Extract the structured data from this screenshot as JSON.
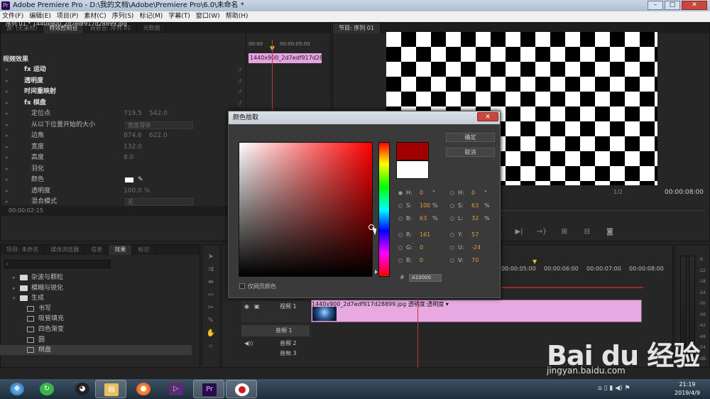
{
  "window": {
    "title": "Adobe Premiere Pro - D:\\我的文档\\Adobe\\Premiere Pro\\6.0\\未命名 *",
    "app_icon": "Pr"
  },
  "menu": [
    "文件(F)",
    "编辑(E)",
    "项目(P)",
    "素材(C)",
    "序列(S)",
    "标记(M)",
    "字幕(T)",
    "窗口(W)",
    "帮助(H)"
  ],
  "left_panel": {
    "tabs": [
      "源: (无素材)",
      "特效控制台",
      "调音台: 序列 01",
      "元数据"
    ],
    "active_tab": 1,
    "sequence": "序列 01 * 1440x900_2d7edf917d28899.jpg",
    "section_title": "视频效果",
    "ruler": {
      "start": "00:00",
      "end": "00:00:05:00"
    },
    "clip_label": "1440x900_2d7edf917d28899",
    "rows": [
      {
        "label": "fx  运动",
        "bold": true
      },
      {
        "label": "透明度",
        "bold": true
      },
      {
        "label": "时间重映射",
        "bold": true
      },
      {
        "label": "fx  棋盘",
        "bold": true
      },
      {
        "label": "定位点",
        "v1": "719.5",
        "v2": "542.0"
      },
      {
        "label": "从以下位置开始的大小",
        "dropdown": "宽度滑块"
      },
      {
        "label": "边角",
        "v1": "874.6",
        "v2": "622.0"
      },
      {
        "label": "宽度",
        "v1": "132.0"
      },
      {
        "label": "高度",
        "v1": "8.0"
      },
      {
        "label": "羽化"
      },
      {
        "label": "颜色"
      },
      {
        "label": "透明度",
        "v1": "100.0 %"
      },
      {
        "label": "混合模式",
        "dropdown": "无"
      }
    ],
    "timecode": "00:00:02:15"
  },
  "program_monitor": {
    "tab": "节目: 序列 01",
    "scale": "1/2",
    "timecode": "00:00:08:00"
  },
  "project_panel": {
    "tabs": [
      "项目: 未命名",
      "媒体浏览器",
      "信息",
      "效果",
      "标记"
    ],
    "active_tab": 3,
    "items": [
      {
        "label": "杂波与颗粒",
        "type": "folder",
        "indent": 0
      },
      {
        "label": "模糊与锐化",
        "type": "folder",
        "indent": 0
      },
      {
        "label": "生成",
        "type": "folder",
        "indent": 0,
        "open": true
      },
      {
        "label": "书写",
        "type": "effect",
        "indent": 1
      },
      {
        "label": "吸管填充",
        "type": "effect",
        "indent": 1
      },
      {
        "label": "四色渐变",
        "type": "effect",
        "indent": 1
      },
      {
        "label": "圆",
        "type": "effect",
        "indent": 1
      },
      {
        "label": "棋盘",
        "type": "effect",
        "indent": 1,
        "selected": true
      }
    ]
  },
  "timeline": {
    "ruler": [
      "00:00:05:00",
      "00:00:06:00",
      "00:00:07:00",
      "00:00:08:00"
    ],
    "tracks": [
      {
        "name": "视频 1",
        "type": "video"
      },
      {
        "name": "音频 1",
        "type": "audio"
      },
      {
        "name": "音频 2",
        "type": "audio"
      },
      {
        "name": "音频 3",
        "type": "audio"
      }
    ],
    "clip_label": "1440x900_2d7edf917d28899.jpg  透明度:透明度 ▾"
  },
  "meter_db": [
    "-6",
    "-12",
    "-18",
    "-24",
    "-30",
    "-36",
    "-42",
    "-48",
    "-54",
    "-dB"
  ],
  "color_picker": {
    "title": "颜色拾取",
    "ok": "确定",
    "cancel": "取消",
    "new_color": "#A10000",
    "old_color": "#FFFFFF",
    "left_fields": [
      {
        "k": "H:",
        "v": "0",
        "u": "°",
        "on": true
      },
      {
        "k": "S:",
        "v": "100",
        "u": "%"
      },
      {
        "k": "B:",
        "v": "63",
        "u": "%"
      },
      {
        "k": "R:",
        "v": "161",
        "u": ""
      },
      {
        "k": "G:",
        "v": "0",
        "u": ""
      },
      {
        "k": "B:",
        "v": "0",
        "u": ""
      }
    ],
    "right_fields": [
      {
        "k": "H:",
        "v": "0",
        "u": "°"
      },
      {
        "k": "S:",
        "v": "63",
        "u": "%"
      },
      {
        "k": "L:",
        "v": "32",
        "u": "%"
      },
      {
        "k": "Y:",
        "v": "57",
        "u": ""
      },
      {
        "k": "U:",
        "v": "-24",
        "u": ""
      },
      {
        "k": "V:",
        "v": "70",
        "u": ""
      }
    ],
    "hex_prefix": "#",
    "hex": "A10000",
    "web_only": "仅网页颜色"
  },
  "taskbar": {
    "time": "21:19",
    "date": "2019/4/9",
    "apps": [
      "start-orb",
      "green-app",
      "qq",
      "explorer",
      "firefox",
      "media",
      "premiere",
      "recorder"
    ]
  },
  "watermark": {
    "brand": "Bai du 经验",
    "url": "jingyan.baidu.com"
  }
}
